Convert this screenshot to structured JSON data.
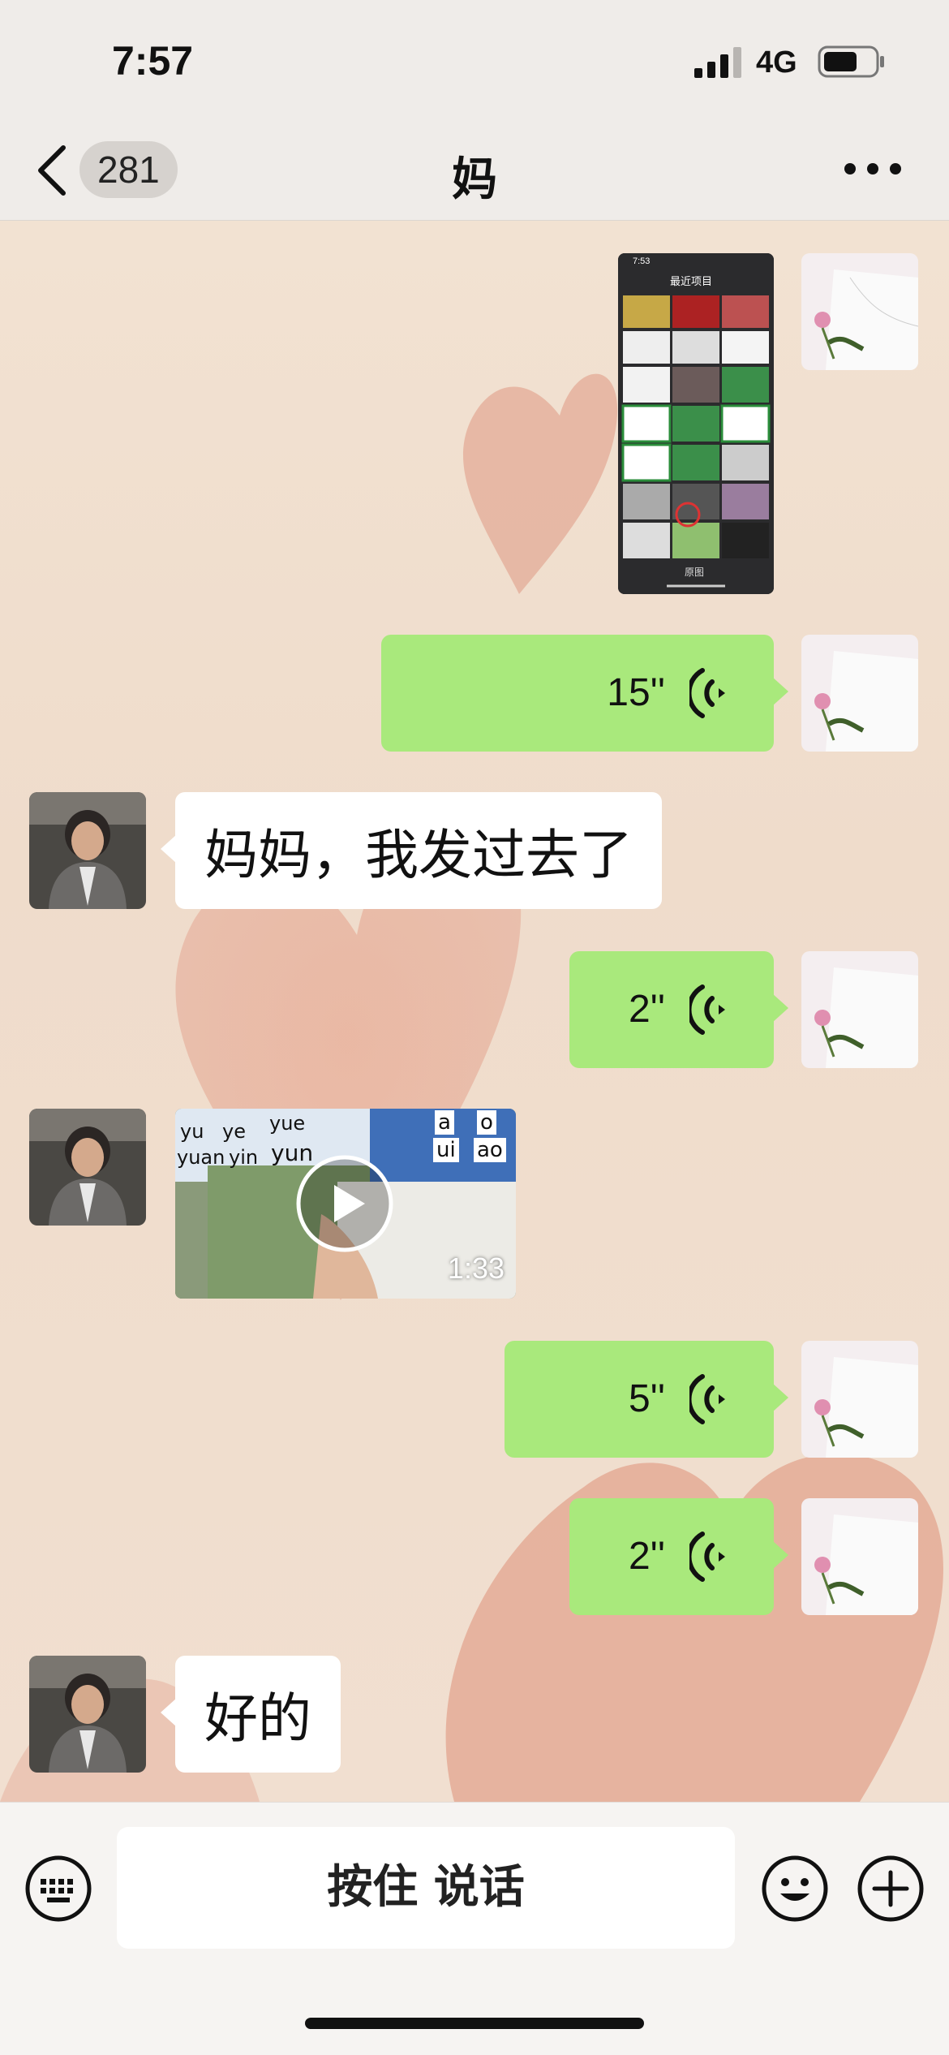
{
  "status_bar": {
    "time": "7:57",
    "network": "4G"
  },
  "nav": {
    "unread_count": "281",
    "title": "妈"
  },
  "messages": [
    {
      "type": "image",
      "side": "right",
      "inner_time": "7:53",
      "inner_title": "最近项目",
      "inner_footer": "原图"
    },
    {
      "type": "voice",
      "side": "right",
      "duration": "15''"
    },
    {
      "type": "text",
      "side": "left",
      "text": "妈妈，我发过去了"
    },
    {
      "type": "voice",
      "side": "right",
      "duration": "2''"
    },
    {
      "type": "video",
      "side": "left",
      "duration": "1:33",
      "pinyin": [
        "yu",
        "ye",
        "yue",
        "yuan",
        "yin",
        "yun",
        "a",
        "o",
        "ui",
        "ao"
      ]
    },
    {
      "type": "voice",
      "side": "right",
      "duration": "5''"
    },
    {
      "type": "voice",
      "side": "right",
      "duration": "2''"
    },
    {
      "type": "text",
      "side": "left",
      "text": "好的"
    }
  ],
  "input_bar": {
    "hold_to_talk": "按住 说话"
  },
  "colors": {
    "sent_bubble": "#a9e97c",
    "received_bubble": "#ffffff",
    "nav_bg": "#efece9"
  },
  "icons": [
    "back-icon",
    "more-icon",
    "voice-icon",
    "play-icon",
    "keyboard-icon",
    "emoji-icon",
    "plus-icon"
  ]
}
